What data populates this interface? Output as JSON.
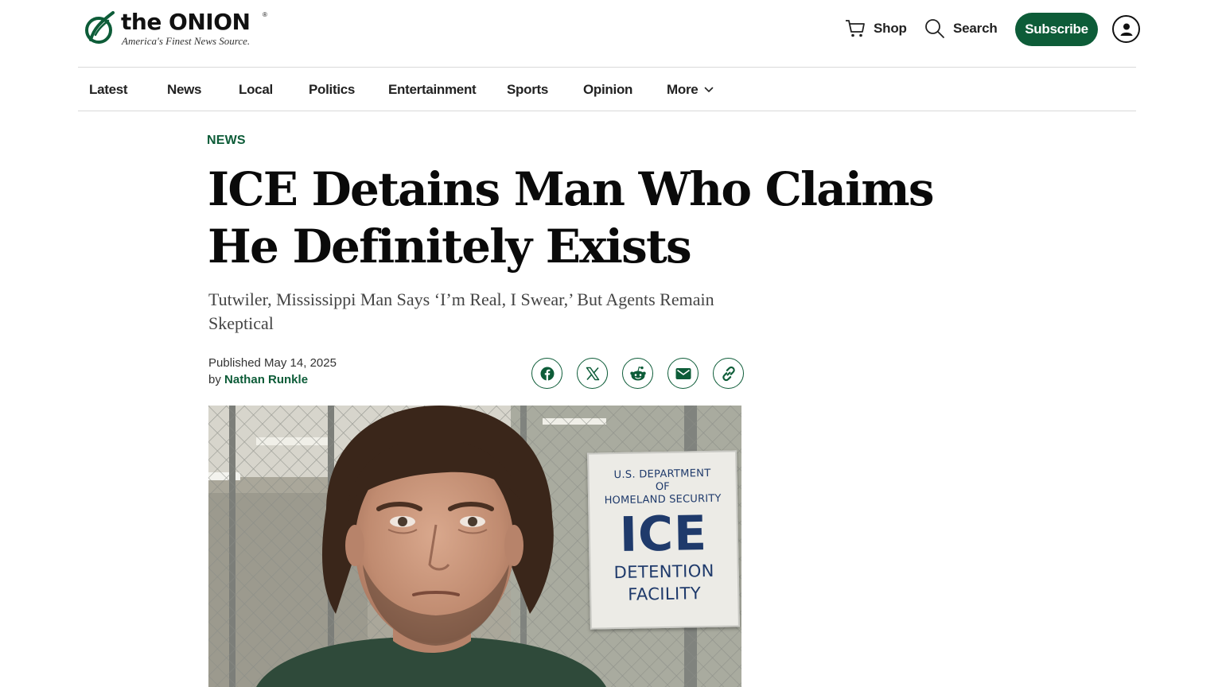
{
  "brand": {
    "name": "the ONION",
    "registered": "®",
    "tagline": "America's Finest News Source.",
    "color": "#0d5c38"
  },
  "header": {
    "shop_label": "Shop",
    "search_label": "Search",
    "subscribe_label": "Subscribe",
    "icons": [
      "cart-icon",
      "search-icon",
      "account-icon"
    ]
  },
  "nav": {
    "items": [
      {
        "label": "Latest"
      },
      {
        "label": "News"
      },
      {
        "label": "Local"
      },
      {
        "label": "Politics"
      },
      {
        "label": "Entertainment"
      },
      {
        "label": "Sports"
      },
      {
        "label": "Opinion"
      },
      {
        "label": "More"
      }
    ]
  },
  "article": {
    "section": "NEWS",
    "headline_line1": "ICE Detains Man Who Claims",
    "headline_line2": "He Definitely Exists",
    "dek": "Tutwiler, Mississippi Man Says ‘I’m Real, I Swear,’ But Agents Remain Skeptical",
    "published": "Published May 14, 2025",
    "by": "by",
    "author": "Nathan Runkle"
  },
  "share": {
    "icons": [
      "facebook-icon",
      "x-icon",
      "reddit-icon",
      "email-icon",
      "link-icon"
    ]
  },
  "hero_image": {
    "sign_line1": "U.S. DEPARTMENT",
    "sign_line2": "OF",
    "sign_line3": "HOMELAND SECURITY",
    "sign_big": "ICE",
    "sign_line5": "DETENTION",
    "sign_line6": "FACILITY"
  }
}
